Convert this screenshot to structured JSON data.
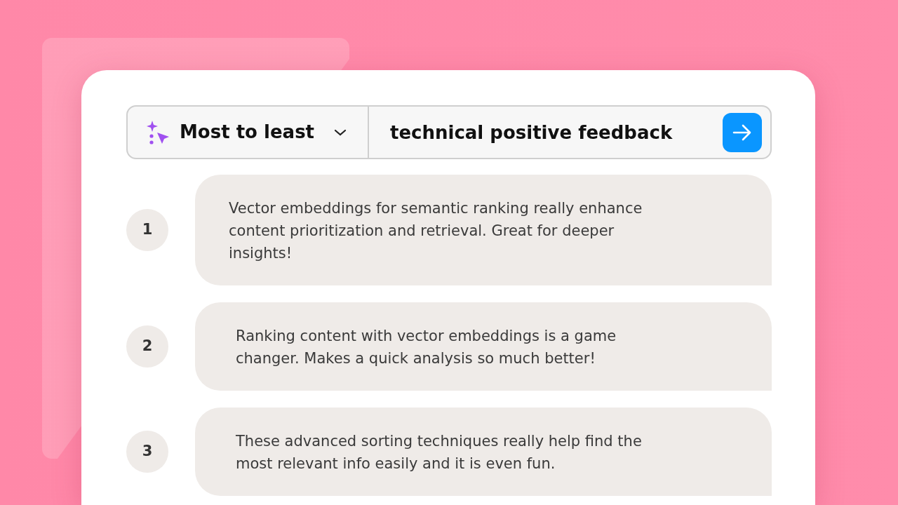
{
  "search_bar": {
    "sort": "Most to least",
    "query": "technical positive feedback"
  },
  "results": [
    {
      "rank": "1",
      "text": "Vector embeddings for semantic ranking really enhance content prioritization and retrieval. Great for deeper insights!"
    },
    {
      "rank": "2",
      "text": "Ranking content with vector embeddings is a game changer. Makes a quick analysis so much better!"
    },
    {
      "rank": "3",
      "text": "These advanced sorting techniques really help find the most relevant info easily and it is even fun."
    }
  ]
}
